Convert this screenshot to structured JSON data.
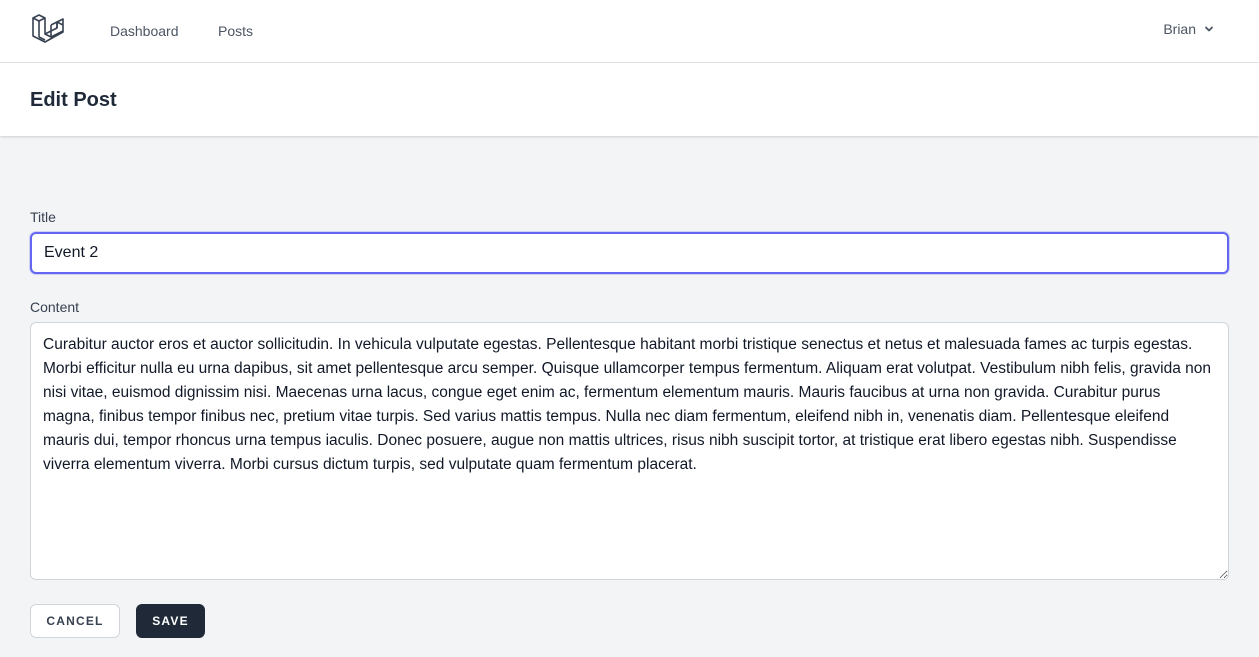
{
  "nav": {
    "links": [
      {
        "label": "Dashboard"
      },
      {
        "label": "Posts"
      }
    ],
    "user_name": "Brian"
  },
  "header": {
    "title": "Edit Post"
  },
  "form": {
    "title_label": "Title",
    "title_value": "Event 2",
    "content_label": "Content",
    "content_value": "Curabitur auctor eros et auctor sollicitudin. In vehicula vulputate egestas. Pellentesque habitant morbi tristique senectus et netus et malesuada fames ac turpis egestas. Morbi efficitur nulla eu urna dapibus, sit amet pellentesque arcu semper. Quisque ullamcorper tempus fermentum. Aliquam erat volutpat. Vestibulum nibh felis, gravida non nisi vitae, euismod dignissim nisi. Maecenas urna lacus, congue eget enim ac, fermentum elementum mauris. Mauris faucibus at urna non gravida. Curabitur purus magna, finibus tempor finibus nec, pretium vitae turpis. Sed varius mattis tempus. Nulla nec diam fermentum, eleifend nibh in, venenatis diam. Pellentesque eleifend mauris dui, tempor rhoncus urna tempus iaculis. Donec posuere, augue non mattis ultrices, risus nibh suscipit tortor, at tristique erat libero egestas nibh. Suspendisse viverra elementum viverra. Morbi cursus dictum turpis, sed vulputate quam fermentum placerat.",
    "cancel_label": "Cancel",
    "save_label": "Save"
  },
  "icons": {
    "logo": "laravel-logo-icon",
    "user_dropdown": "chevron-down-icon"
  },
  "colors": {
    "focus_ring": "#6366f1",
    "primary_button": "#1f2937",
    "page_background": "#f3f4f6"
  }
}
